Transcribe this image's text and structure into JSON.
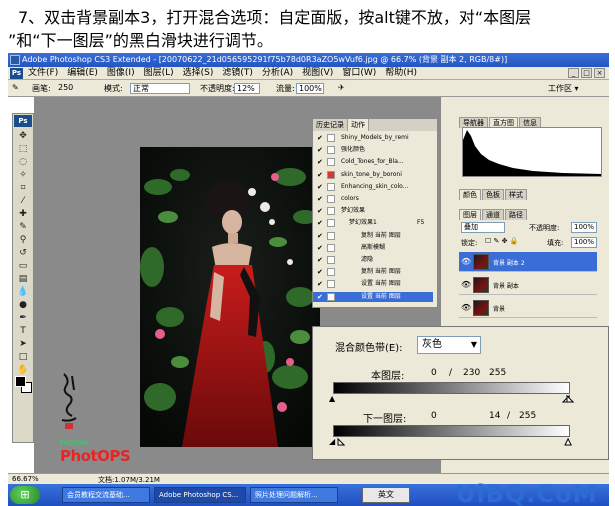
{
  "instruction": {
    "line1": "7、双击背景副本3，打开混合选项：自定面版，按alt键不放，对“本图层",
    "line2": "”和“下一图层”的黑白滑块进行调节。"
  },
  "window": {
    "title": "Adobe Photoshop CS3 Extended - [20070622_21d056595291f75b78d0R3aZO5wVuf6.jpg @ 66.7% (背景 副本 2, RGB/8#)]",
    "ps_badge": "Ps"
  },
  "menubar": {
    "items": [
      "文件(F)",
      "编辑(E)",
      "图像(I)",
      "图层(L)",
      "选择(S)",
      "滤镜(T)",
      "分析(A)",
      "视图(V)",
      "窗口(W)",
      "帮助(H)"
    ],
    "controls": [
      "_",
      "□",
      "×"
    ]
  },
  "options": {
    "brush_label": "画笔:",
    "brush_size": "250",
    "mode_label": "模式:",
    "mode_value": "正常",
    "opacity_label": "不透明度:",
    "opacity_value": "12%",
    "flow_label": "流量:",
    "flow_value": "100%",
    "workspace_label": "工作区 ▾"
  },
  "actions_panel": {
    "tabs": [
      "历史记录",
      "动作"
    ],
    "rows": [
      {
        "text": "Shiny_Models_by_remi",
        "red": false,
        "selected": false
      },
      {
        "text": "强化颜色",
        "red": false,
        "selected": false
      },
      {
        "text": "Cold_Tones_for_Bla...",
        "red": false,
        "selected": false
      },
      {
        "text": "skin_tone_by_boroni",
        "red": true,
        "selected": false
      },
      {
        "text": "Enhancing_skin_colo...",
        "red": false,
        "selected": false
      },
      {
        "text": "colors",
        "red": false,
        "selected": false
      },
      {
        "text": "梦幻效果",
        "red": false,
        "selected": false
      },
      {
        "text": "梦幻效果1",
        "suffix": "F5",
        "red": false,
        "selected": false
      },
      {
        "text": "复制 当前 图层",
        "red": false,
        "selected": false
      },
      {
        "text": "高斯模糊",
        "red": false,
        "selected": false
      },
      {
        "text": "滤隐",
        "red": false,
        "selected": false
      },
      {
        "text": "复制 当前 图层",
        "red": false,
        "selected": false
      },
      {
        "text": "设置 当前 图层",
        "red": false,
        "selected": false
      },
      {
        "text": "设置 当前 图层",
        "red": false,
        "selected": true
      }
    ]
  },
  "right_panels": {
    "top_tabs": [
      "导航器",
      "直方图",
      "信息"
    ],
    "mid_tabs": [
      "颜色",
      "色板",
      "样式"
    ],
    "layer_tabs": [
      "图层",
      "通道",
      "路径"
    ],
    "blend_mode": "叠加",
    "opacity_label": "不透明度:",
    "opacity_value": "100%",
    "lock_label": "锁定:",
    "fill_label": "填充:",
    "fill_value": "100%",
    "layers": [
      {
        "name": "背景 副本 2",
        "selected": true
      },
      {
        "name": "背景 副本",
        "selected": false
      },
      {
        "name": "背景",
        "selected": false
      }
    ]
  },
  "blend_dialog": {
    "blend_if_label": "混合颜色带(E):",
    "blend_if_value": "灰色",
    "this_layer_label": "本图层:",
    "this_layer_values": [
      "0",
      "/",
      "230",
      "255"
    ],
    "underlying_label": "下一图层:",
    "underlying_values": [
      "0",
      "14",
      "/",
      "255"
    ]
  },
  "canvas": {
    "logo_site": "PHOTOPS",
    "logo_brand": "PhotOPS"
  },
  "status": {
    "zoom": "66.67%",
    "doc": "文档:1.07M/3.21M"
  },
  "taskbar": {
    "start": "⊞",
    "tasks": [
      "会员教程交流基础...",
      "Adobe Photoshop CS...",
      "照片处理问题解析..."
    ],
    "lang": "英文"
  },
  "watermark": "UiBQ.CoM"
}
